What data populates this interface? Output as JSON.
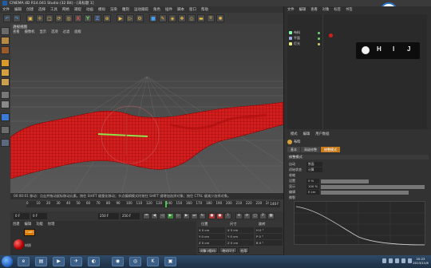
{
  "window": {
    "title": "CINEMA 4D R14.041 Studio (32 Bit) - [未标题 1]"
  },
  "menubar": [
    "文件",
    "编辑",
    "创建",
    "选择",
    "工具",
    "网格",
    "捕捉",
    "动画",
    "模拟",
    "渲染",
    "雕刻",
    "运动跟踪",
    "角色",
    "插件",
    "脚本",
    "窗口",
    "帮助"
  ],
  "toolbar": {
    "buttons": [
      {
        "name": "undo-icon",
        "glyph": "↶"
      },
      {
        "name": "redo-icon",
        "glyph": "↷"
      },
      {
        "name": "live-select-icon",
        "glyph": "▣"
      },
      {
        "name": "move-icon",
        "glyph": "✛"
      },
      {
        "name": "scale-icon",
        "glyph": "▢"
      },
      {
        "name": "rotate-icon",
        "glyph": "⟳"
      },
      {
        "name": "last-tool-icon",
        "glyph": "◎"
      },
      {
        "name": "x-axis-lock",
        "glyph": "X"
      },
      {
        "name": "y-axis-lock",
        "glyph": "Y"
      },
      {
        "name": "z-axis-lock",
        "glyph": "Z"
      },
      {
        "name": "coordinate-system-icon",
        "glyph": "⊕"
      },
      {
        "name": "render-view-icon",
        "glyph": "▶"
      },
      {
        "name": "render-picture-viewer-icon",
        "glyph": "▷"
      },
      {
        "name": "render-settings-icon",
        "glyph": "⚙"
      },
      {
        "name": "cube-icon",
        "glyph": "■"
      },
      {
        "name": "pen-icon",
        "glyph": "✎"
      },
      {
        "name": "subdivision-icon",
        "glyph": "◈"
      },
      {
        "name": "array-icon",
        "glyph": "❖"
      },
      {
        "name": "deformer-icon",
        "glyph": "◇"
      },
      {
        "name": "floor-icon",
        "glyph": "▬"
      },
      {
        "name": "camera-icon",
        "glyph": "⌾"
      },
      {
        "name": "light-icon",
        "glyph": "✺"
      }
    ]
  },
  "viewport": {
    "title": "透视视图",
    "menu": [
      "查看",
      "摄像机",
      "显示",
      "选项",
      "过滤",
      "面板"
    ]
  },
  "status": {
    "text": "00:00:01  移动：点击并拖动鼠标移动元素。按住 SHIFT 键量化移动；节点编辑模式时按住 SHIFT 键增加选择对象；按住 CTRL 键减少选择对象。"
  },
  "timeline": {
    "ticks": [
      "0",
      "10",
      "20",
      "30",
      "40",
      "50",
      "60",
      "70",
      "80",
      "90",
      "100",
      "110",
      "120",
      "130",
      "140",
      "150",
      "160",
      "170",
      "180",
      "190",
      "200",
      "210",
      "220",
      "230",
      "240"
    ],
    "current_frame": "140 F",
    "current_frame_fraction": 0.58
  },
  "playback": {
    "start": "0 F",
    "end": "250 F",
    "min": "0 F",
    "max": "250 F"
  },
  "materials": {
    "menu": [
      "创建",
      "编辑",
      "功能",
      "纹理"
    ],
    "thumb_label": "Cloth",
    "item_name": "材质"
  },
  "coords": {
    "headers": [
      "位置",
      "尺寸",
      "旋转"
    ],
    "rows": [
      [
        "X  0 cm",
        "X  0 cm",
        "H  0 °"
      ],
      [
        "Y  0 cm",
        "Y  0 cm",
        "P  0 °"
      ],
      [
        "Z  0 cm",
        "Z  0 cm",
        "B  0 °"
      ]
    ],
    "mode": "对象 (相对)",
    "size_mode": "绝对尺寸",
    "apply": "应用"
  },
  "objects": {
    "menu": [
      "文件",
      "编辑",
      "查看",
      "对象",
      "标签",
      "书签"
    ],
    "rows": [
      "布料",
      "平面",
      "灯光"
    ]
  },
  "key_overlay": [
    "H",
    "I",
    "J"
  ],
  "attributes": {
    "menu": [
      "模式",
      "编辑",
      "用户数据"
    ],
    "object": "布料",
    "tabs": [
      "基本",
      "高级修整",
      "修整模式"
    ],
    "active_tab": 2,
    "section": "修整模式",
    "lines": [
      "自动",
      "初始状态",
      "收缩",
      "设置",
      "显示",
      "编辑",
      "撕裂",
      "修正"
    ],
    "fields": [
      "铁面",
      "计算",
      "0 %",
      "100 %",
      "0 cm"
    ]
  },
  "taskbar": {
    "apps": [
      "ie-icon",
      "explorer-icon",
      "media-icon",
      "qq-icon",
      "browser-icon",
      "chrome-icon",
      "c4d-icon",
      "photoshop-icon",
      "video-icon"
    ],
    "time": "20:23",
    "date": "2013/11/6"
  }
}
